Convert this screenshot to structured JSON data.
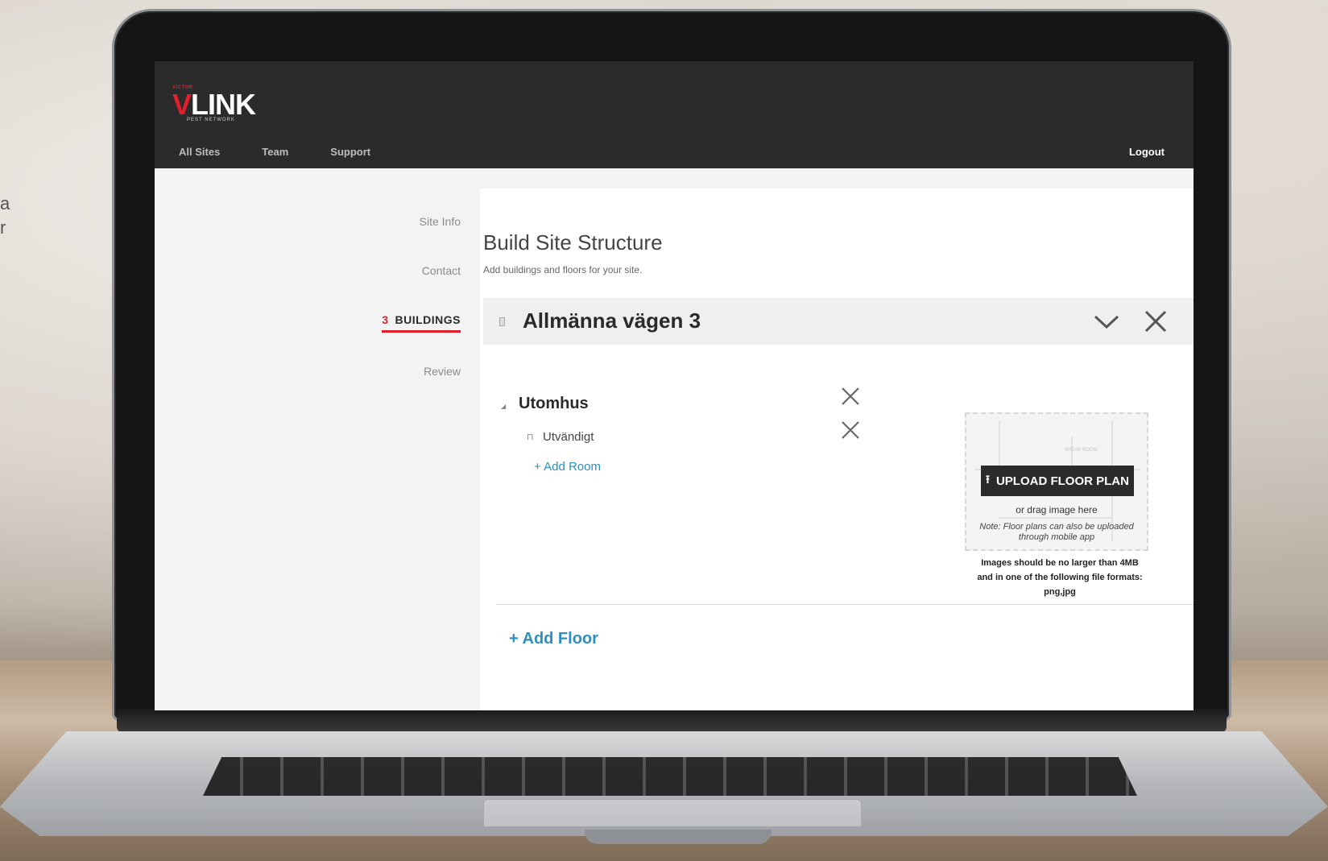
{
  "background": {
    "edge_text": "a\nr"
  },
  "header": {
    "logo": {
      "small": "VICTOR",
      "main_v": "V",
      "main_rest": "LINK",
      "tag": "PEST NETWORK"
    },
    "nav": [
      "All Sites",
      "Team",
      "Support"
    ],
    "logout": "Logout"
  },
  "steps": {
    "site_info": "Site Info",
    "contact": "Contact",
    "buildings_num": "3",
    "buildings": "BUILDINGS",
    "review": "Review"
  },
  "page": {
    "title": "Build Site Structure",
    "subtitle": "Add buildings and floors for your site."
  },
  "building": {
    "name": "Allmänna vägen 3",
    "floor": {
      "name": "Utomhus",
      "room": "Utvändigt",
      "add_room": "+ Add Room"
    }
  },
  "upload": {
    "plan_label": "BREAK ROOM",
    "button": "UPLOAD FLOOR PLAN",
    "drag": "or drag image here",
    "note": "Note: Floor plans can also be uploaded through mobile app",
    "limits": "Images should be no larger than 4MB and in one of the following file formats: png,jpg"
  },
  "add_floor": "+ Add Floor",
  "colors": {
    "brand_red": "#e31e2c",
    "link_blue": "#2f8fc1",
    "header_bg": "#2b2b2b"
  }
}
